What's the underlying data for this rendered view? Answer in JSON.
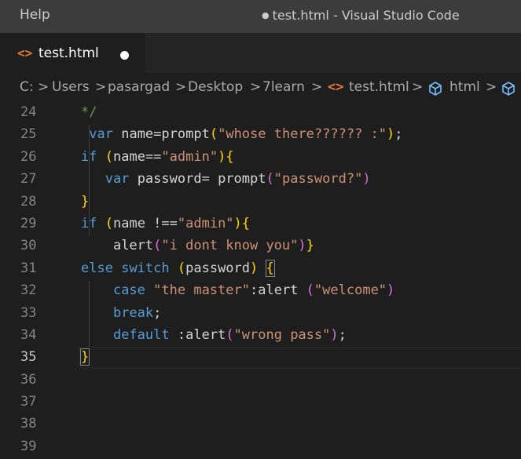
{
  "titlebar": {
    "menu_help": "Help",
    "dirty_dot": "●",
    "title": "test.html - Visual Studio Code"
  },
  "tab": {
    "icon": "html-file-icon",
    "label": "test.html",
    "dirty": true
  },
  "breadcrumb": {
    "drive": "C:",
    "users": "Users",
    "user": "pasargad",
    "desktop": "Desktop",
    "folder": "7learn",
    "file": "test.html",
    "symbol": "html",
    "sep": ">"
  },
  "editor": {
    "active_line": 35,
    "lines": [
      {
        "n": "24"
      },
      {
        "n": "25"
      },
      {
        "n": "26"
      },
      {
        "n": "27"
      },
      {
        "n": "28"
      },
      {
        "n": "29"
      },
      {
        "n": "30"
      },
      {
        "n": "31"
      },
      {
        "n": "32"
      },
      {
        "n": "33"
      },
      {
        "n": "34"
      },
      {
        "n": "35"
      },
      {
        "n": "36"
      },
      {
        "n": "37"
      },
      {
        "n": "38"
      },
      {
        "n": "39"
      }
    ],
    "code": {
      "l24_comment": "*/",
      "l25_var": "var",
      "l25_name": "name",
      "l25_eq": "=",
      "l25_fn": "prompt",
      "l25_open": "(",
      "l25_str": "\"whose there?????? :\"",
      "l25_close": ")",
      "l25_semi": ";",
      "l26_if": "if",
      "l26_open": "(",
      "l26_name": "name",
      "l26_op": "==",
      "l26_str": "\"admin\"",
      "l26_close": ")",
      "l26_brace": "{",
      "l27_var": "var",
      "l27_name": "password",
      "l27_eq": "= ",
      "l27_fn": "prompt",
      "l27_open": "(",
      "l27_str": "\"password?\"",
      "l27_close": ")",
      "l28_brace": "}",
      "l29_if": "if",
      "l29_open": "(",
      "l29_name": "name",
      "l29_op": " !==",
      "l29_str": "\"admin\"",
      "l29_close": ")",
      "l29_brace": "{",
      "l30_fn": "alert",
      "l30_open": "(",
      "l30_str": "\"i dont know you\"",
      "l30_close": ")",
      "l30_brace": "}",
      "l31_else": "else",
      "l31_switch": "switch",
      "l31_open": "(",
      "l31_name": "password",
      "l31_close": ")",
      "l31_brace": "{",
      "l32_case": "case",
      "l32_str": "\"the master\"",
      "l32_colon": ":",
      "l32_fn": "alert",
      "l32_open": "(",
      "l32_str2": "\"welcome\"",
      "l32_close": ")",
      "l33_break": "break",
      "l33_semi": ";",
      "l34_default": "default",
      "l34_colon": ":",
      "l34_fn": "alert",
      "l34_open": "(",
      "l34_str": "\"wrong pass\"",
      "l34_close": ")",
      "l34_semi": ";",
      "l35_brace": "}"
    }
  }
}
